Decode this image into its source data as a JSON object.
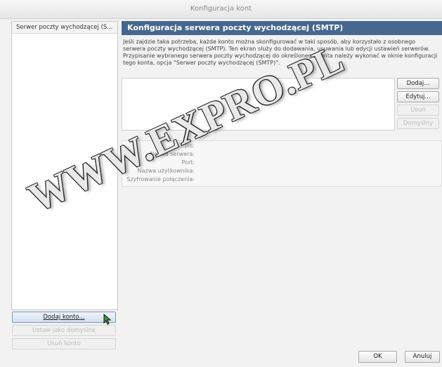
{
  "window": {
    "title": "Konfiguracja kont"
  },
  "sidebar": {
    "header": "Serwer poczty wychodzącej (S...",
    "add_account": "Dodaj konto...",
    "set_default": "Ustaw jako domyślne",
    "remove_account": "Usuń konto"
  },
  "main": {
    "title": "Konfiguracja serwera poczty wychodzącej (SMTP)",
    "description": "Jeśli zajdzie taka potrzeba, każde konto można skonfigurować w taki sposób, aby korzystało z osobnego serwera poczty wychodzącej (SMTP). Ten ekran służy do dodawania, usuwania lub edycji ustawień serwerów. Przypisanie wybranego serwera poczty wychodzącej do określonego konta należy wykonać w oknie konfiguracji tego konta, opcja \"Serwer poczty wychodzącej (SMTP)\".",
    "buttons": {
      "add": "Dodaj...",
      "edit": "Edytuj...",
      "remove": "Usuń",
      "default": "Domyślny"
    },
    "details": {
      "description_label": "Opis:",
      "server_label": "Nazwa serwera:",
      "port_label": "Port:",
      "username_label": "Nazwa użytkownika:",
      "encryption_label": "Szyfrowanie połączenia:"
    }
  },
  "footer": {
    "ok": "OK",
    "cancel": "Anuluj"
  },
  "watermark": "WWW.EXPRO.PL",
  "colors": {
    "header_bg": "#46678e",
    "header_text": "#ffffff",
    "window_bg": "#f2f2f2"
  }
}
